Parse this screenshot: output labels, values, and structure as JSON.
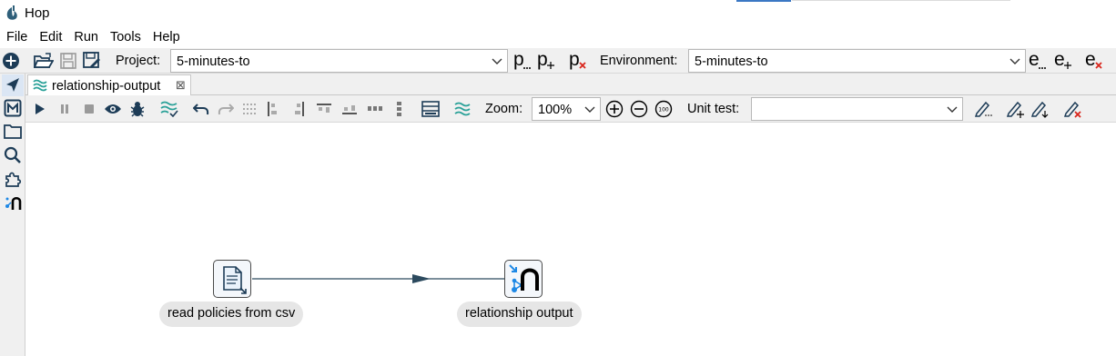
{
  "window": {
    "title": "Hop"
  },
  "menu": [
    "File",
    "Edit",
    "Run",
    "Tools",
    "Help"
  ],
  "toolbar": {
    "project_label": "Project:",
    "project_value": "5-minutes-to",
    "environment_label": "Environment:",
    "environment_value": "5-minutes-to",
    "p_letter": "p",
    "e_letter": "e"
  },
  "tab": {
    "label": "relationship-output",
    "close": "⊠"
  },
  "pipeline_toolbar": {
    "zoom_label": "Zoom:",
    "zoom_value": "100%",
    "unit_test_label": "Unit test:",
    "unit_test_value": ""
  },
  "pipeline": {
    "transforms": [
      {
        "name": "read policies from csv",
        "icon": "csv-file-icon"
      },
      {
        "name": "relationship output",
        "icon": "relationship-output-icon"
      }
    ],
    "hops": [
      {
        "from": "read policies from csv",
        "to": "relationship output"
      }
    ]
  },
  "colors": {
    "accent": "#3b78c4",
    "hop": "#2c4a5e",
    "teal": "#2aa198"
  }
}
